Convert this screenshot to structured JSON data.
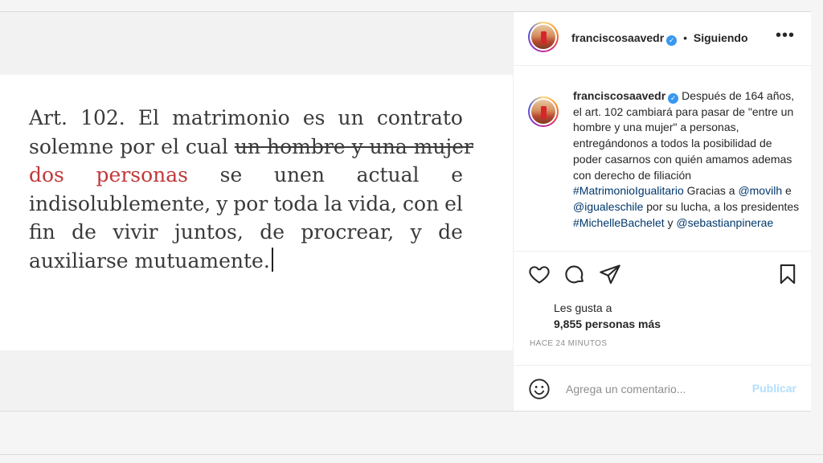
{
  "post": {
    "image_text": {
      "line1": [
        "Art.",
        "102.",
        "El",
        "matrimonio",
        "es",
        "un",
        "contrato"
      ],
      "line2_plain": "solemne por el cual ",
      "line2_struck": "un hombre y una mujer",
      "line3_red": [
        "dos",
        "personas"
      ],
      "line3_rest": [
        "se",
        "unen",
        "actual",
        "e"
      ],
      "line4": [
        "indisolublemente,",
        "y",
        "por",
        "toda",
        "la",
        "vida,",
        "con",
        "el"
      ],
      "line5": [
        "fin",
        "de",
        "vivir",
        "juntos,",
        "de",
        "procrear,",
        "y",
        "de"
      ],
      "line6": "auxiliarse mutuamente."
    }
  },
  "header": {
    "username": "franciscosaavedr",
    "separator": "•",
    "follow_label": "Siguiendo",
    "more_label": "•••"
  },
  "caption": {
    "username": "franciscosaavedr",
    "text1": " Después de 164 años, el art. 102 cambiará para pasar de \"entre un hombre y una mujer\" a personas, entregándonos a todos la posibilidad de poder casarnos con quién amamos ademas con derecho de filiación ",
    "hashtag1": "#MatrimonioIgualitario",
    "text2": " Gracias a ",
    "mention1": "@movilh",
    "text3": " e ",
    "mention2": "@igualeschile",
    "text4": " por su lucha, a los presidentes ",
    "hashtag2": "#MichelleBachelet",
    "text5": " y ",
    "mention3": "@sebastianpinerae"
  },
  "likes": {
    "line1": "Les gusta a",
    "count": "9,855 personas más"
  },
  "timestamp": "HACE 24 MINUTOS",
  "comment_box": {
    "placeholder": "Agrega un comentario...",
    "publish_label": "Publicar"
  },
  "icons": {
    "like": "heart-icon",
    "comment": "comment-icon",
    "share": "share-icon",
    "save": "bookmark-icon",
    "emoji": "emoji-icon"
  },
  "colors": {
    "link": "#00376b",
    "accent_disabled": "#b2dffc",
    "highlight_red": "#c0393b"
  }
}
